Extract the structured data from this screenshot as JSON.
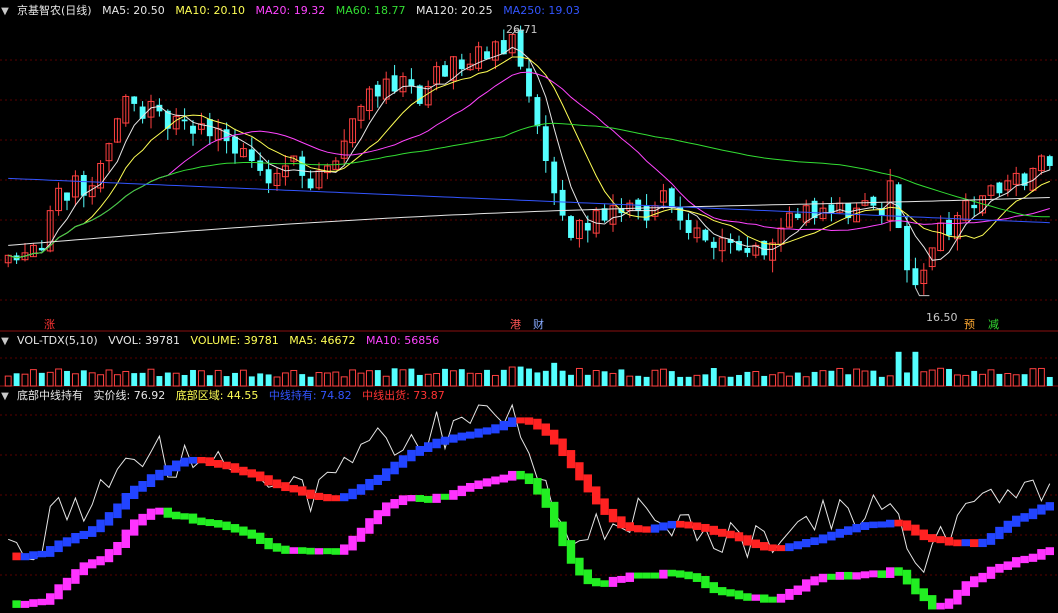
{
  "main_legend": {
    "stock": "京基智农(日线)",
    "items": [
      {
        "label": "MA5: 20.50",
        "color": "#e6e6e6"
      },
      {
        "label": "MA10: 20.10",
        "color": "#ffff55"
      },
      {
        "label": "MA20: 19.32",
        "color": "#ff44ff"
      },
      {
        "label": "MA60: 18.77",
        "color": "#33dd33"
      },
      {
        "label": "MA120: 20.25",
        "color": "#e6e6e6"
      },
      {
        "label": "MA250: 19.03",
        "color": "#3355ff"
      }
    ]
  },
  "price_labels": {
    "high": "26.71",
    "low": "16.50"
  },
  "markers": [
    {
      "text": "涨",
      "color": "#ff3333"
    },
    {
      "text": "港",
      "color": "#ff5555"
    },
    {
      "text": "财",
      "color": "#88aaff"
    },
    {
      "text": "预",
      "color": "#ffaa33"
    },
    {
      "text": "减",
      "color": "#33dd33"
    }
  ],
  "vol_legend": {
    "items": [
      {
        "label": "VOL-TDX(5,10)",
        "color": "#e6e6e6"
      },
      {
        "label": "VVOL: 39781",
        "color": "#e6e6e6"
      },
      {
        "label": "VOLUME: 39781",
        "color": "#ffff55"
      },
      {
        "label": "MA5: 46672",
        "color": "#ffff55"
      },
      {
        "label": "MA10: 56856",
        "color": "#ff44ff"
      }
    ]
  },
  "ind_legend": {
    "items": [
      {
        "label": "底部中线持有",
        "color": "#e6e6e6"
      },
      {
        "label": "实价线: 76.92",
        "color": "#e6e6e6"
      },
      {
        "label": "底部区域: 44.55",
        "color": "#ffff55"
      },
      {
        "label": "中线持有: 74.82",
        "color": "#3355ff"
      },
      {
        "label": "中线出货: 73.87",
        "color": "#ff3333"
      }
    ]
  },
  "chart_data": {
    "type": "candlestick",
    "title": "京基智农(日线)",
    "ylim": [
      16.0,
      27.2
    ],
    "closes": [
      17.8,
      17.6,
      17.9,
      18.2,
      18.0,
      19.6,
      20.5,
      20.0,
      21.0,
      20.2,
      20.6,
      21.5,
      22.3,
      23.3,
      24.2,
      23.9,
      23.3,
      24.0,
      23.6,
      22.9,
      23.4,
      23.2,
      22.7,
      23.1,
      22.6,
      22.9,
      22.4,
      21.9,
      22.1,
      21.6,
      21.2,
      20.7,
      21.1,
      21.4,
      21.8,
      21.0,
      20.5,
      21.2,
      21.4,
      21.6,
      22.4,
      23.3,
      23.8,
      24.5,
      24.2,
      24.9,
      24.4,
      25.0,
      24.6,
      23.9,
      24.6,
      25.4,
      25.0,
      25.8,
      25.3,
      25.5,
      26.2,
      25.7,
      26.4,
      25.9,
      26.7,
      25.4,
      24.2,
      23.0,
      21.6,
      20.3,
      19.4,
      18.5,
      19.2,
      18.8,
      19.6,
      19.2,
      19.8,
      19.5,
      19.9,
      19.6,
      19.2,
      19.8,
      20.4,
      19.7,
      19.2,
      18.7,
      18.9,
      18.4,
      18.1,
      18.5,
      18.3,
      18.0,
      17.9,
      18.2,
      17.8,
      18.3,
      18.9,
      19.5,
      19.3,
      19.8,
      19.3,
      19.7,
      19.5,
      19.9,
      19.3,
      19.7,
      20.0,
      19.8,
      19.4,
      20.8,
      18.9,
      17.2,
      16.6,
      17.2,
      18.1,
      19.1,
      18.6,
      19.4,
      20.0,
      19.7,
      20.2,
      20.6,
      20.3,
      20.8,
      21.1,
      20.6,
      21.3,
      21.8,
      21.4
    ],
    "ma_series": [
      {
        "name": "MA5",
        "value": "20.50"
      },
      {
        "name": "MA10",
        "value": "20.10"
      },
      {
        "name": "MA20",
        "value": "19.32"
      },
      {
        "name": "MA60",
        "value": "18.77"
      },
      {
        "name": "MA120",
        "value": "20.25"
      },
      {
        "name": "MA250",
        "value": "19.03"
      }
    ]
  }
}
